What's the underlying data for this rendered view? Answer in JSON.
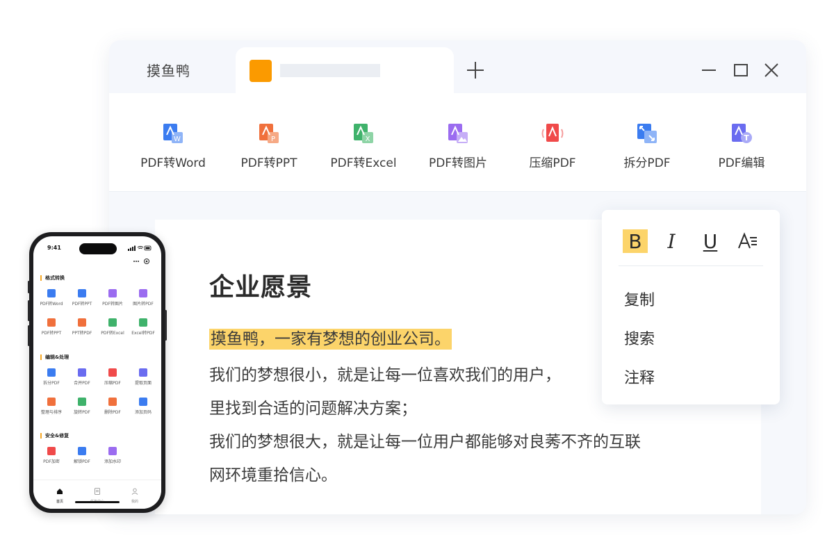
{
  "app": {
    "name": "摸鱼鸭",
    "tab_color": "#fb9a00"
  },
  "toolbar": {
    "tools": [
      {
        "label": "PDF转Word",
        "icon": "pdf-to-word-icon",
        "color": "#3b7cf0"
      },
      {
        "label": "PDF转PPT",
        "icon": "pdf-to-ppt-icon",
        "color": "#f0703c"
      },
      {
        "label": "PDF转Excel",
        "icon": "pdf-to-excel-icon",
        "color": "#3fb26b"
      },
      {
        "label": "PDF转图片",
        "icon": "pdf-to-image-icon",
        "color": "#9b6cf0"
      },
      {
        "label": "压缩PDF",
        "icon": "compress-pdf-icon",
        "color": "#f04a4a"
      },
      {
        "label": "拆分PDF",
        "icon": "split-pdf-icon",
        "color": "#3b7cf0"
      },
      {
        "label": "PDF编辑",
        "icon": "pdf-edit-icon",
        "color": "#6a6cf0"
      }
    ]
  },
  "document": {
    "title": "企业愿景",
    "highlighted_line": "摸鱼鸭，一家有梦想的创业公司。",
    "lines": [
      "我们的梦想很小，就是让每一位喜欢我们的用户，",
      "里找到合适的问题解决方案；",
      "我们的梦想很大，就是让每一位用户都能够对良莠不齐的互联",
      "网环境重拾信心。"
    ],
    "highlight_color": "#fcd46a"
  },
  "context_menu": {
    "format_buttons": {
      "bold": "B",
      "italic": "I",
      "underline": "U",
      "text_style": "A"
    },
    "items": [
      "复制",
      "搜索",
      "注释"
    ]
  },
  "phone": {
    "time": "9:41",
    "sections": [
      {
        "title": "格式转换",
        "items": [
          {
            "label": "PDF转Word",
            "color": "#3b7cf0"
          },
          {
            "label": "PDF转PPT",
            "color": "#3b7cf0"
          },
          {
            "label": "PDF转图片",
            "color": "#9b6cf0"
          },
          {
            "label": "图片转PDF",
            "color": "#9b6cf0"
          },
          {
            "label": "PDF转PPT",
            "color": "#f0703c"
          },
          {
            "label": "PPT转PDF",
            "color": "#f0703c"
          },
          {
            "label": "PDF转Excel",
            "color": "#3fb26b"
          },
          {
            "label": "Excel转PDF",
            "color": "#3fb26b"
          }
        ]
      },
      {
        "title": "编辑&处理",
        "items": [
          {
            "label": "拆分PDF",
            "color": "#3b7cf0"
          },
          {
            "label": "合并PDF",
            "color": "#6a6cf0"
          },
          {
            "label": "压缩PDF",
            "color": "#f04a4a"
          },
          {
            "label": "提取页面",
            "color": "#6a6cf0"
          },
          {
            "label": "整理与排序",
            "color": "#f0703c"
          },
          {
            "label": "旋转PDF",
            "color": "#3fb26b"
          },
          {
            "label": "删除PDF",
            "color": "#f0703c"
          },
          {
            "label": "添加页码",
            "color": "#3b7cf0"
          }
        ]
      },
      {
        "title": "安全&修复",
        "items": [
          {
            "label": "PDF加密",
            "color": "#f04a4a"
          },
          {
            "label": "解锁PDF",
            "color": "#3b7cf0"
          },
          {
            "label": "添加水印",
            "color": "#9b6cf0"
          }
        ]
      }
    ],
    "nav": [
      {
        "label": "首页",
        "icon": "home-icon"
      },
      {
        "label": "任务中心",
        "icon": "task-center-icon"
      },
      {
        "label": "我的",
        "icon": "profile-icon"
      }
    ]
  }
}
